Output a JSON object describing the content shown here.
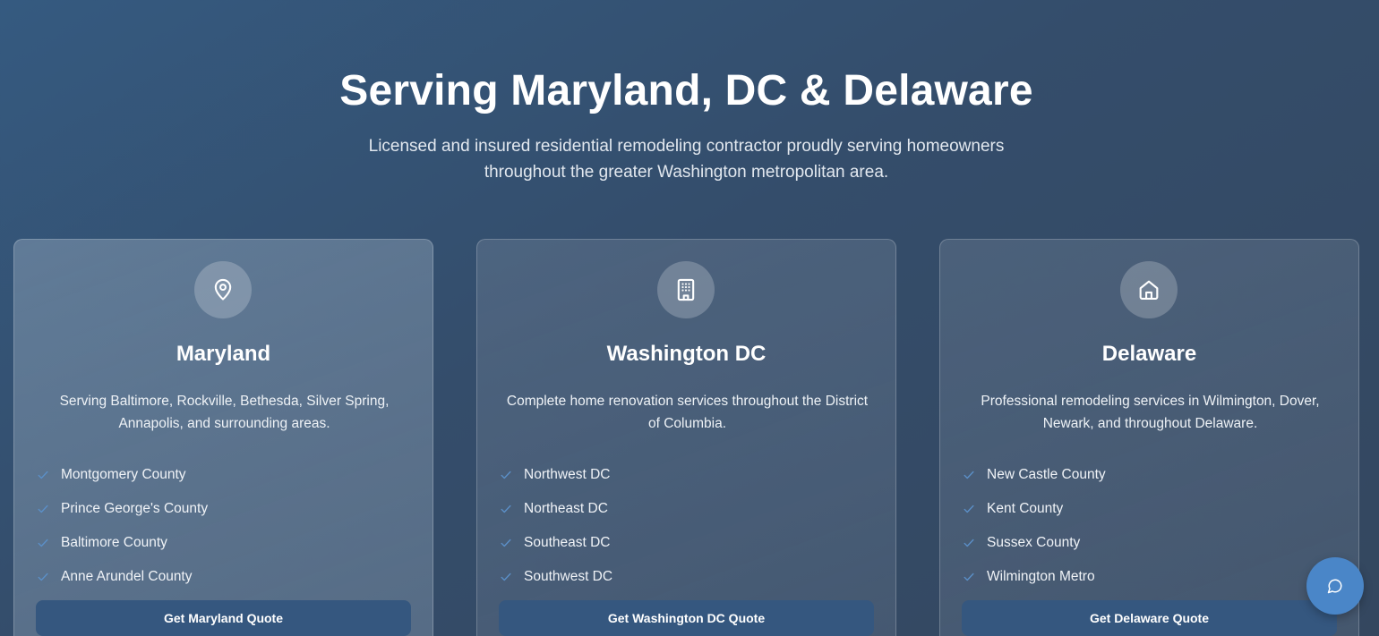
{
  "hero": {
    "title": "Serving Maryland, DC & Delaware",
    "subtitle_line1": "Licensed and insured residential remodeling contractor proudly serving homeowners",
    "subtitle_line2": "throughout the greater Washington metropolitan area."
  },
  "cards": [
    {
      "icon": "map-pin-icon",
      "title": "Maryland",
      "desc_line1": "Serving Baltimore, Rockville, Bethesda, Silver Spring,",
      "desc_line2": "Annapolis, and surrounding areas.",
      "areas": [
        "Montgomery County",
        "Prince George's County",
        "Baltimore County",
        "Anne Arundel County"
      ],
      "button": "Get Maryland Quote"
    },
    {
      "icon": "building-icon",
      "title": "Washington DC",
      "desc_line1": "Complete home renovation services throughout the District",
      "desc_line2": "of Columbia.",
      "areas": [
        "Northwest DC",
        "Northeast DC",
        "Southeast DC",
        "Southwest DC"
      ],
      "button": "Get Washington DC Quote"
    },
    {
      "icon": "home-icon",
      "title": "Delaware",
      "desc_line1": "Professional remodeling services in Wilmington, Dover,",
      "desc_line2": "Newark, and throughout Delaware.",
      "areas": [
        "New Castle County",
        "Kent County",
        "Sussex County",
        "Wilmington Metro"
      ],
      "button": "Get Delaware Quote"
    }
  ],
  "chat": {
    "icon": "chat-bubble-icon"
  },
  "colors": {
    "accent_button": "#35577f",
    "check": "#5b8fc7",
    "chat_fab": "#4a86c8"
  }
}
